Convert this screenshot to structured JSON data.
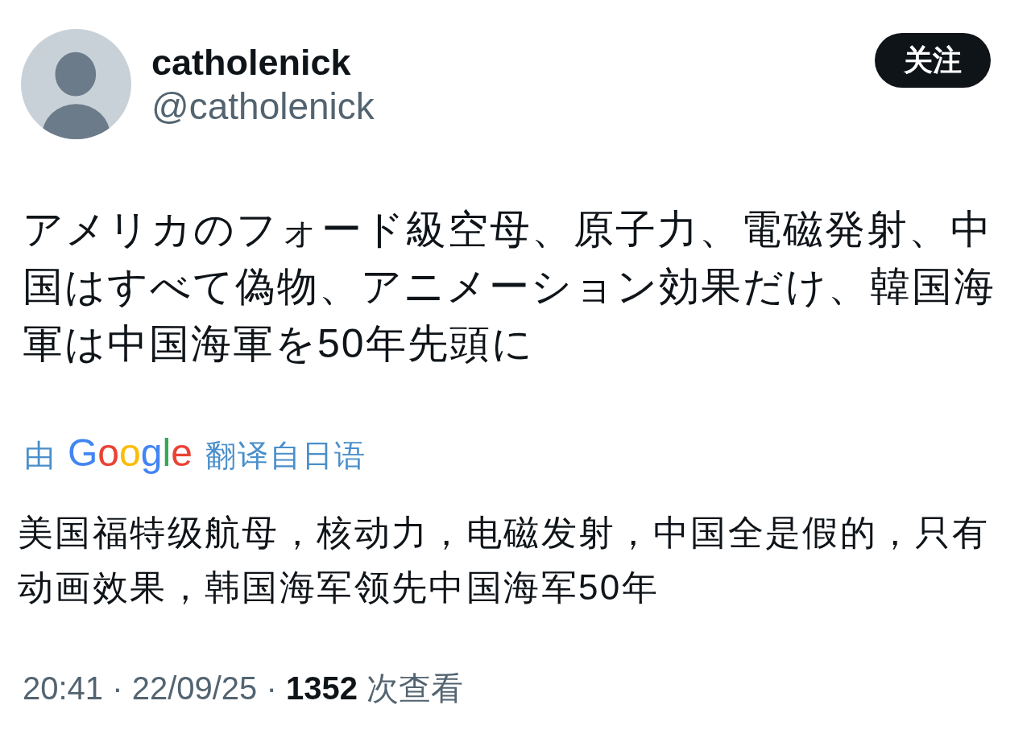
{
  "post": {
    "author": {
      "name": "catholenick",
      "handle": "@catholenick"
    },
    "follow_button": {
      "label": "关注"
    },
    "text": "アメリカのフォード級空母、原子力、電磁発射、中国はすべて偽物、アニメーション効果だけ、韓国海軍は中国海軍を50年先頭に",
    "translation_note": {
      "prefix": "由",
      "service": "Google",
      "suffix": "翻译自日语"
    },
    "translation": "美国福特级航母，核动力，电磁发射，中国全是假的，只有动画效果，韩国海军领先中国海军50年",
    "meta": "20:41 · 22/09/25 · **1352** 次查看"
  }
}
